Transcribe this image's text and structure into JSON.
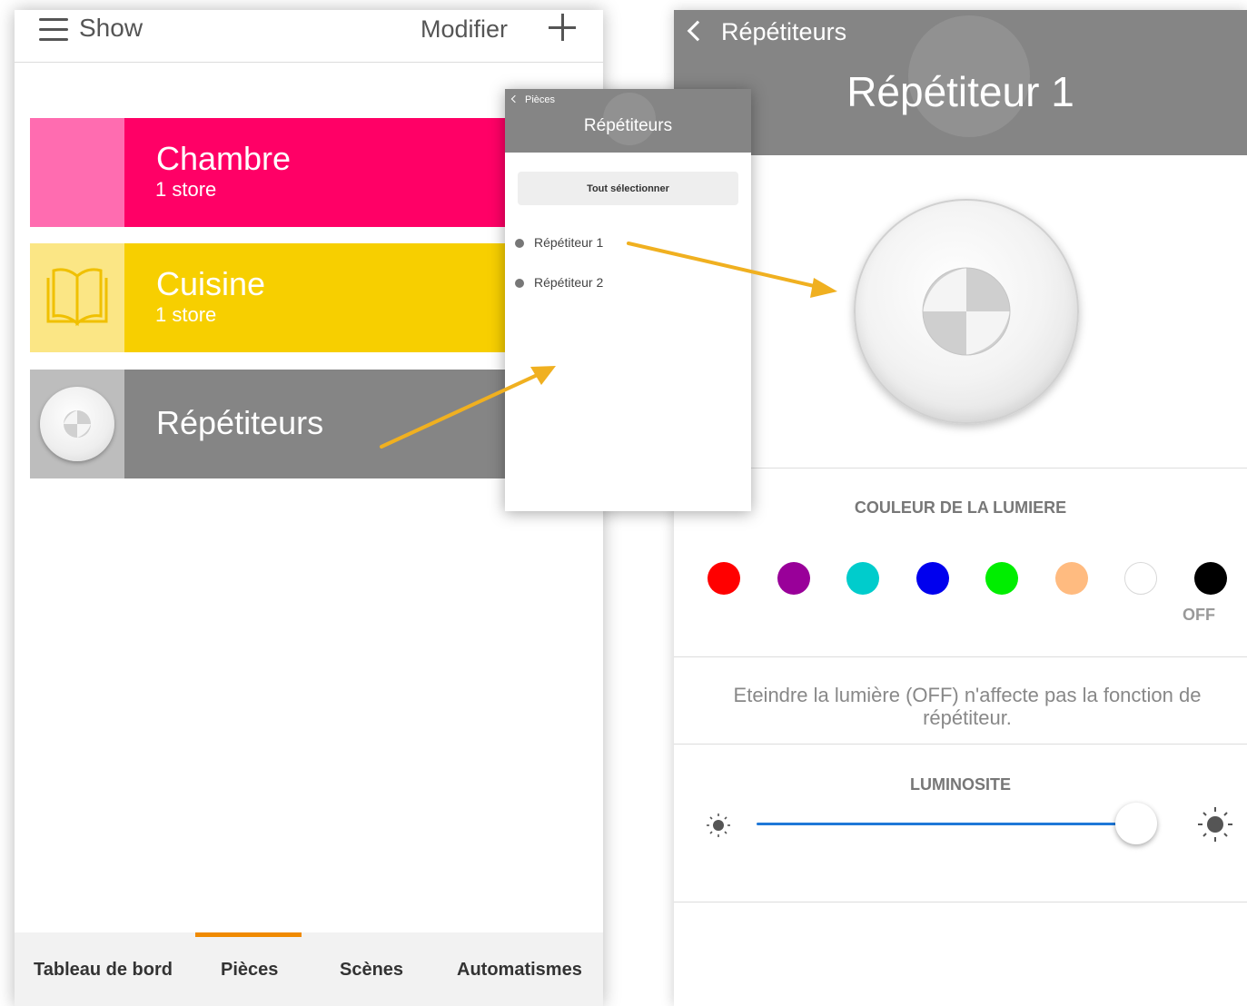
{
  "left": {
    "header": {
      "menu_label": "Show",
      "edit_label": "Modifier"
    },
    "rooms": [
      {
        "name": "Chambre",
        "subtitle": "1 store",
        "color": "#ff0066",
        "thumb_color": "#ff6cb0"
      },
      {
        "name": "Cuisine",
        "subtitle": "1 store",
        "color": "#f7cf00",
        "thumb_color": "#fbe685"
      },
      {
        "name": "Répétiteurs",
        "subtitle": "",
        "color": "#858585",
        "thumb_color": "#bdbdbd"
      }
    ],
    "tabs": [
      {
        "label": "Tableau de bord"
      },
      {
        "label": "Pièces"
      },
      {
        "label": "Scènes"
      },
      {
        "label": "Automatismes"
      }
    ],
    "active_tab": "Pièces",
    "accent": "#f08a00"
  },
  "popup": {
    "back_label": "Pièces",
    "title": "Répétiteurs",
    "select_all_label": "Tout sélectionner",
    "items": [
      {
        "label": "Répétiteur 1"
      },
      {
        "label": "Répétiteur 2"
      }
    ]
  },
  "detail": {
    "back_label": "Répétiteurs",
    "title": "Répétiteur 1",
    "color_section_label": "COULEUR DE LA LUMIERE",
    "colors": [
      "#ff0000",
      "#990099",
      "#00cccc",
      "#0000ee",
      "#00ee00",
      "#ffbb80",
      "#ffffff",
      "#000000"
    ],
    "off_label": "OFF",
    "notice": "Eteindre la lumière (OFF) n'affecte pas la fonction de répétiteur.",
    "brightness_label": "LUMINOSITE",
    "brightness_value": 0.95,
    "slider_color": "#1f78d8"
  },
  "arrow_color": "#f0b020"
}
